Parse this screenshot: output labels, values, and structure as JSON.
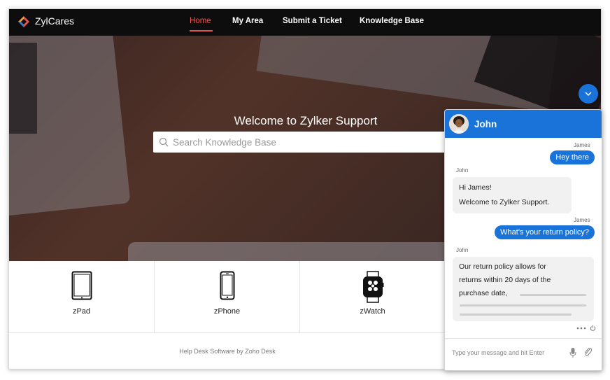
{
  "header": {
    "brand": "ZylCares",
    "nav": [
      "Home",
      "My Area",
      "Submit a Ticket",
      "Knowledge Base"
    ],
    "active_nav": "Home"
  },
  "hero": {
    "title": "Welcome to Zylker Support",
    "search_placeholder": "Search Knowledge Base"
  },
  "products": [
    {
      "label": "zPad",
      "icon": "tablet-icon"
    },
    {
      "label": "zPhone",
      "icon": "phone-icon"
    },
    {
      "label": "zWatch",
      "icon": "watch-icon"
    }
  ],
  "footer": {
    "text": "Help Desk Software by Zoho Desk"
  },
  "chat": {
    "agent": "John",
    "messages": [
      {
        "from": "James",
        "text": "Hey there"
      },
      {
        "from": "John",
        "lines": [
          "Hi James!",
          "Welcome to Zylker Support."
        ]
      },
      {
        "from": "James",
        "text": "What's your return policy?"
      },
      {
        "from": "John",
        "lines": [
          "Our return policy allows for",
          "returns within 20 days of the",
          "purchase date,"
        ]
      }
    ],
    "input_placeholder": "Type your message and hit Enter"
  },
  "colors": {
    "accent": "#1a73d9",
    "nav_active": "#e8554e",
    "topbar": "#0d0d0d"
  }
}
